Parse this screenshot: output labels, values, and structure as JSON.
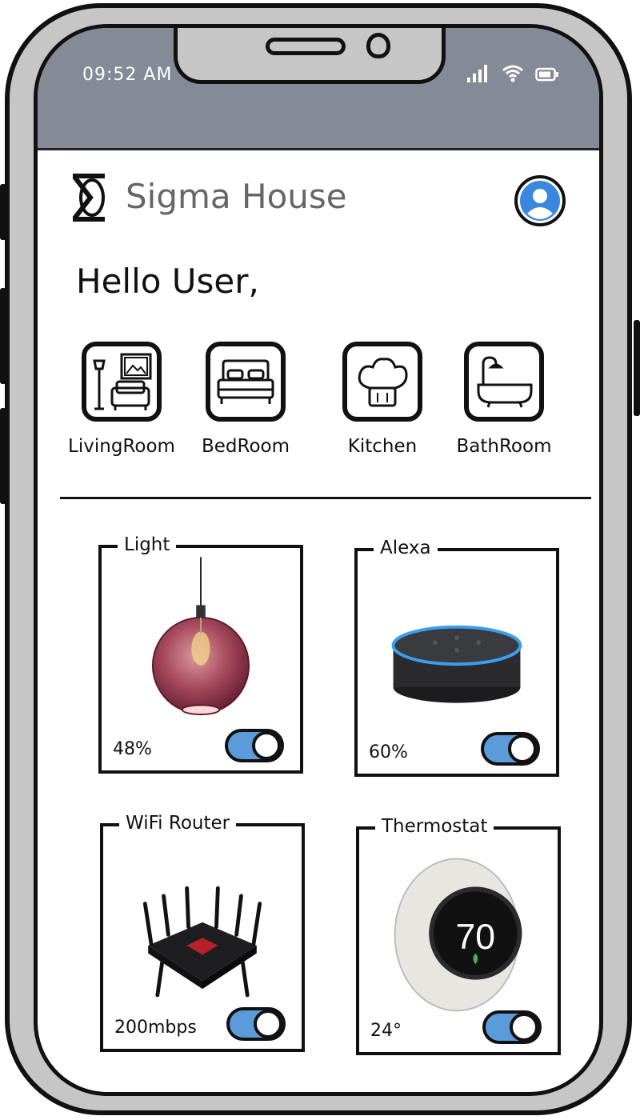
{
  "status_bar": {
    "time": "09:52 AM"
  },
  "header": {
    "app_title": "Sigma House",
    "logo_icon": "sigma-logo-icon",
    "avatar_icon": "user-avatar-icon"
  },
  "greeting": "Hello User,",
  "rooms": [
    {
      "label": "LivingRoom",
      "icon": "living-room-icon"
    },
    {
      "label": "BedRoom",
      "icon": "bed-icon"
    },
    {
      "label": "Kitchen",
      "icon": "chef-hat-icon"
    },
    {
      "label": "BathRoom",
      "icon": "bathtub-icon"
    }
  ],
  "devices": [
    {
      "title": "Light",
      "value": "48%",
      "on": true
    },
    {
      "title": "Alexa",
      "value": "60%",
      "on": true
    },
    {
      "title": "WiFi Router",
      "value": "200mbps",
      "on": true
    },
    {
      "title": "Thermostat",
      "value": "24°",
      "on": true,
      "display": "70"
    }
  ],
  "colors": {
    "status_bar": "#858b96",
    "toggle_on": "#5b9bd9",
    "avatar": "#3a87e0",
    "frame": "#c6c6c6"
  }
}
